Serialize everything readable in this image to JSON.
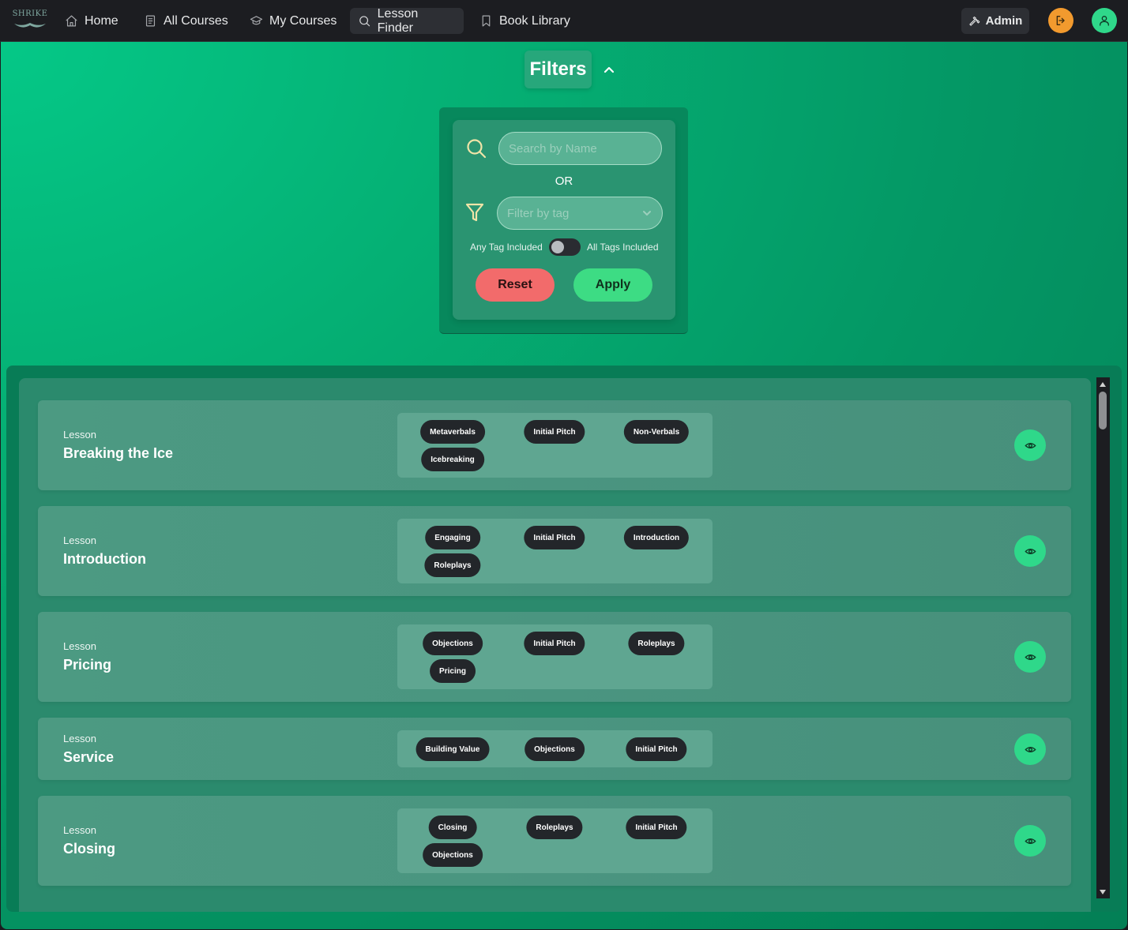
{
  "nav": {
    "logo_text": "SHRIKE",
    "items": [
      {
        "label": "Home",
        "icon": "home-icon"
      },
      {
        "label": "All Courses",
        "icon": "book-icon"
      },
      {
        "label": "My Courses",
        "icon": "graduation-cap-icon"
      },
      {
        "label": "Lesson Finder",
        "icon": "search-icon"
      },
      {
        "label": "Book Library",
        "icon": "bookmark-icon"
      }
    ],
    "active": "Lesson Finder",
    "admin_label": "Admin"
  },
  "colors": {
    "accent_green": "#2fd88a",
    "logout_orange": "#f29a2e",
    "reset_red": "#f26b6b",
    "apply_green": "#3ddc84",
    "tag_dark": "#23262a"
  },
  "filters": {
    "title": "Filters",
    "search_placeholder": "Search by Name",
    "or_label": "OR",
    "tag_placeholder": "Filter by tag",
    "toggle_left": "Any Tag Included",
    "toggle_right": "All Tags Included",
    "toggle_on": false,
    "reset_label": "Reset",
    "apply_label": "Apply"
  },
  "lessons": [
    {
      "type": "Lesson",
      "title": "Breaking the Ice",
      "tags": [
        "Metaverbals",
        "Initial Pitch",
        "Non-Verbals",
        "Icebreaking"
      ]
    },
    {
      "type": "Lesson",
      "title": "Introduction",
      "tags": [
        "Engaging",
        "Initial Pitch",
        "Introduction",
        "Roleplays"
      ]
    },
    {
      "type": "Lesson",
      "title": "Pricing",
      "tags": [
        "Objections",
        "Initial Pitch",
        "Roleplays",
        "Pricing"
      ]
    },
    {
      "type": "Lesson",
      "title": "Service",
      "tags": [
        "Building Value",
        "Objections",
        "Initial Pitch"
      ]
    },
    {
      "type": "Lesson",
      "title": "Closing",
      "tags": [
        "Closing",
        "Roleplays",
        "Initial Pitch",
        "Objections"
      ]
    }
  ]
}
